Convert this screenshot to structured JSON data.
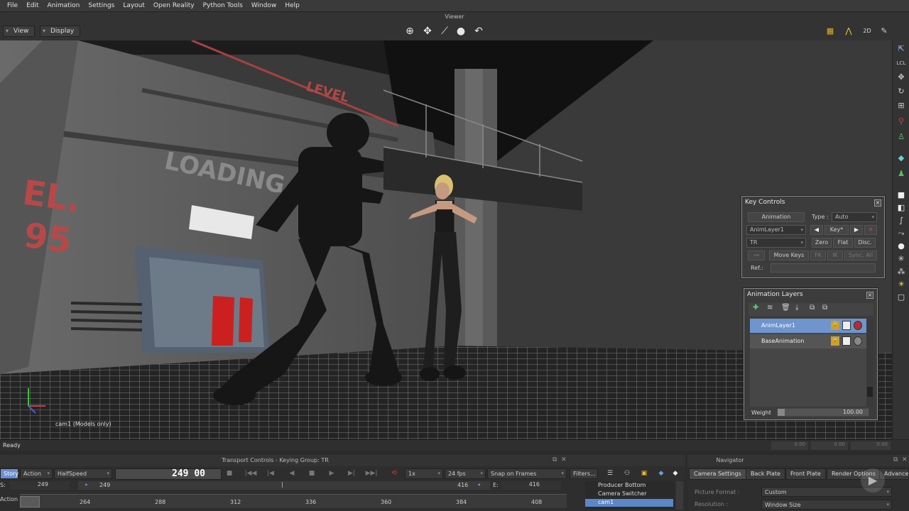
{
  "menubar": {
    "items": [
      "File",
      "Edit",
      "Animation",
      "Settings",
      "Layout",
      "Open Reality",
      "Python Tools",
      "Window",
      "Help"
    ]
  },
  "viewer": {
    "title": "Viewer",
    "view_label": "View",
    "display_label": "Display",
    "camera_label": "cam1 (Models only)",
    "tool_icons": [
      "orbit-icon",
      "move-icon",
      "line-icon",
      "sphere-icon",
      "undo-arc-icon"
    ],
    "top_right_icons": [
      "grid-icon",
      "snap-icon",
      "2d-icon",
      "draw-icon"
    ],
    "top_right_2d": "2D",
    "scene_sign_loading": "LOADING",
    "scene_sign_level": "LEVEL",
    "scene_sign_number": "95"
  },
  "key_controls": {
    "title": "Key Controls",
    "animation_label": "Animation",
    "type_label": "Type :",
    "type_value": "Auto",
    "layer_value": "AnimLayer1",
    "key_label": "Key*",
    "channel_value": "TR",
    "zero_label": "Zero",
    "flat_label": "Flat",
    "disc_label": "Disc.",
    "move_keys_label": "Move Keys",
    "fk_label": "FK",
    "ik_label": "IK",
    "sync_label": "Sync. All",
    "ref_label": "Ref.:"
  },
  "animation_layers": {
    "title": "Animation Layers",
    "layers": [
      {
        "name": "AnimLayer1",
        "selected": true
      },
      {
        "name": "BaseAnimation",
        "selected": false
      }
    ],
    "weight_label": "Weight",
    "weight_value": "100.00"
  },
  "status": {
    "text": "Ready",
    "coord_x": "0.00",
    "coord_y": "0.00",
    "coord_z": "0.00"
  },
  "transport": {
    "title": "Transport Controls - Keying Group: TR",
    "story_tab": "Story",
    "action_tab": "Action",
    "speed": "HalfSpeed",
    "frame_display": "249 00",
    "speed_mult": "1x",
    "fps": "24 fps",
    "snap": "Snap on Frames",
    "filters_label": "Filters...",
    "start_label": "S:",
    "start_value": "249",
    "start_value2": "249",
    "end_label": "E:",
    "end_value": "416",
    "end_value2": "416",
    "action_label": "Action",
    "ticks": [
      "264",
      "288",
      "312",
      "336",
      "360",
      "384",
      "408"
    ],
    "cameras": [
      "Producer Bottom",
      "Camera Switcher",
      "cam1"
    ]
  },
  "navigator": {
    "title": "Navigator",
    "tabs": [
      "Camera Settings",
      "Back Plate",
      "Front Plate",
      "Render Options",
      "Advanced"
    ],
    "picture_format_label": "Picture Format :",
    "picture_format_value": "Custom",
    "resolution_label": "Resolution :",
    "resolution_value": "Window Size"
  },
  "colors": {
    "accent_blue": "#5b86c9",
    "story_tab": "#6c8fd0",
    "selected_layer": "#6f95cf",
    "close_red": "#d04040"
  }
}
